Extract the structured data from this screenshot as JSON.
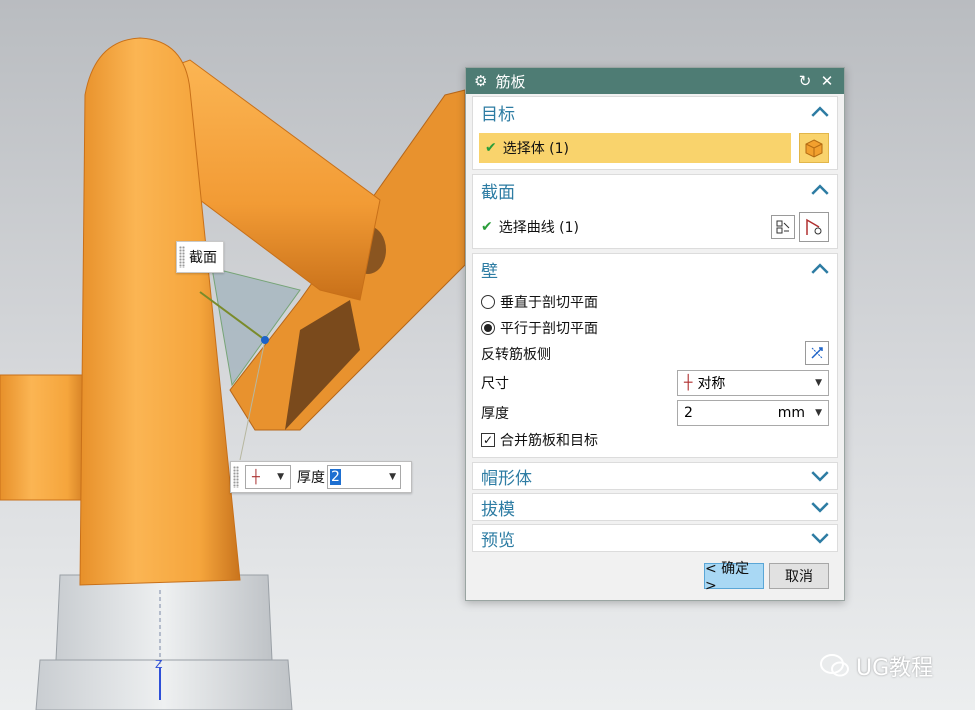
{
  "viewport": {
    "section_tag": "截面",
    "float_bar": {
      "thickness_label": "厚度",
      "thickness_value": "2"
    },
    "axis_label": "Z",
    "watermark": "UG教程"
  },
  "dialog": {
    "title": "筋板",
    "target": {
      "header": "目标",
      "select_body": "选择体 (1)"
    },
    "section": {
      "header": "截面",
      "select_curve": "选择曲线 (1)"
    },
    "wall": {
      "header": "壁",
      "option_perpendicular": "垂直于剖切平面",
      "option_parallel": "平行于剖切平面",
      "selected_option": "parallel",
      "flip_label": "反转筋板侧",
      "size_label": "尺寸",
      "size_value": "对称",
      "thickness_label": "厚度",
      "thickness_value": "2",
      "thickness_unit": "mm",
      "merge_label": "合并筋板和目标",
      "merge_checked": true
    },
    "cap": {
      "header": "帽形体"
    },
    "draft": {
      "header": "拔模"
    },
    "preview": {
      "header": "预览"
    },
    "ok_label": "< 确定 >",
    "cancel_label": "取消"
  },
  "colors": {
    "part": "#f5a53c",
    "title_bar": "#4e7c74",
    "section_header": "#2d7ca3",
    "selection": "#f9d36c"
  }
}
